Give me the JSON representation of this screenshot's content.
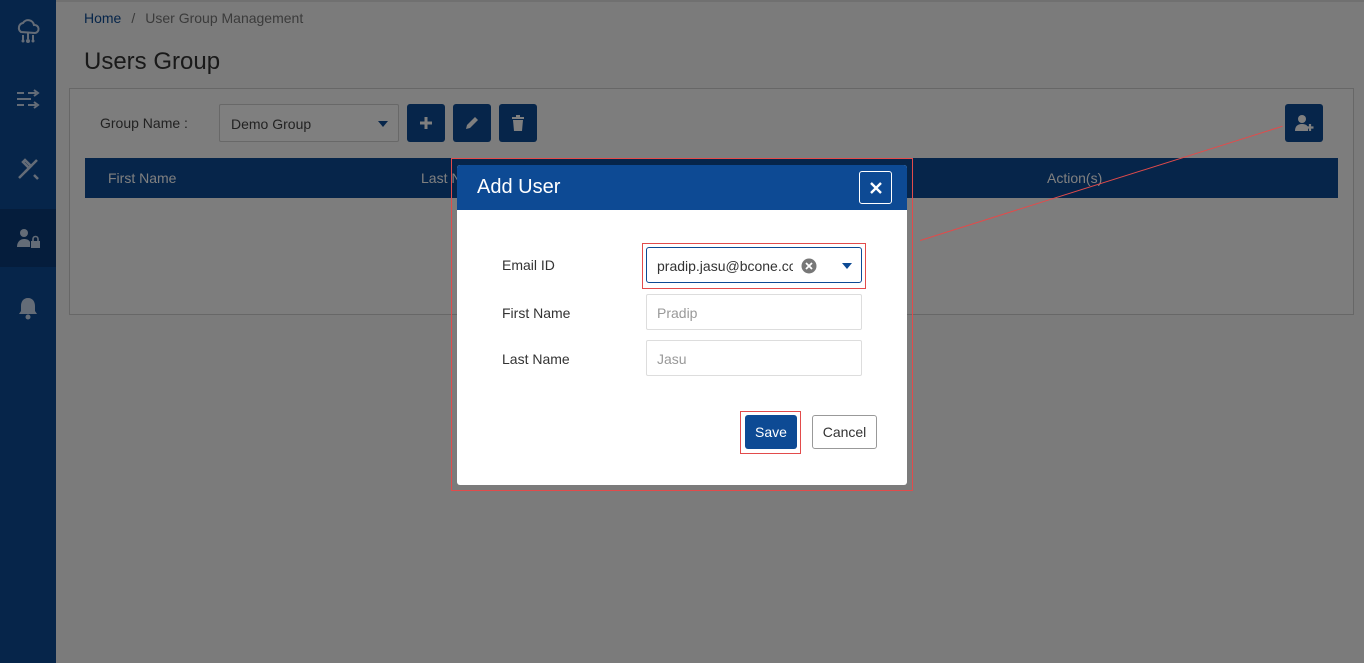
{
  "breadcrumb": {
    "home": "Home",
    "separator": "/",
    "current": "User Group Management"
  },
  "page_title": "Users Group",
  "sidebar": {
    "items": [
      {
        "icon": "cloud-network-icon"
      },
      {
        "icon": "shuffle-icon"
      },
      {
        "icon": "tools-icon"
      },
      {
        "icon": "user-lock-icon",
        "active": true
      },
      {
        "icon": "bell-icon"
      }
    ]
  },
  "group": {
    "label": "Group Name :",
    "selected": "Demo Group",
    "buttons": [
      "plus-icon",
      "pencil-icon",
      "trash-icon"
    ],
    "add_user_icon": "user-plus-icon"
  },
  "table": {
    "headers": [
      "First Name",
      "Last N",
      "Action(s)"
    ]
  },
  "modal": {
    "title": "Add User",
    "close_icon": "close-icon",
    "fields": {
      "email": {
        "label": "Email ID",
        "value": "pradip.jasu@bcone.cc"
      },
      "first_name": {
        "label": "First Name",
        "placeholder": "Pradip"
      },
      "last_name": {
        "label": "Last Name",
        "placeholder": "Jasu"
      }
    },
    "save_label": "Save",
    "cancel_label": "Cancel"
  },
  "colors": {
    "primary": "#0d4a94",
    "annotation": "#e24b4b"
  }
}
